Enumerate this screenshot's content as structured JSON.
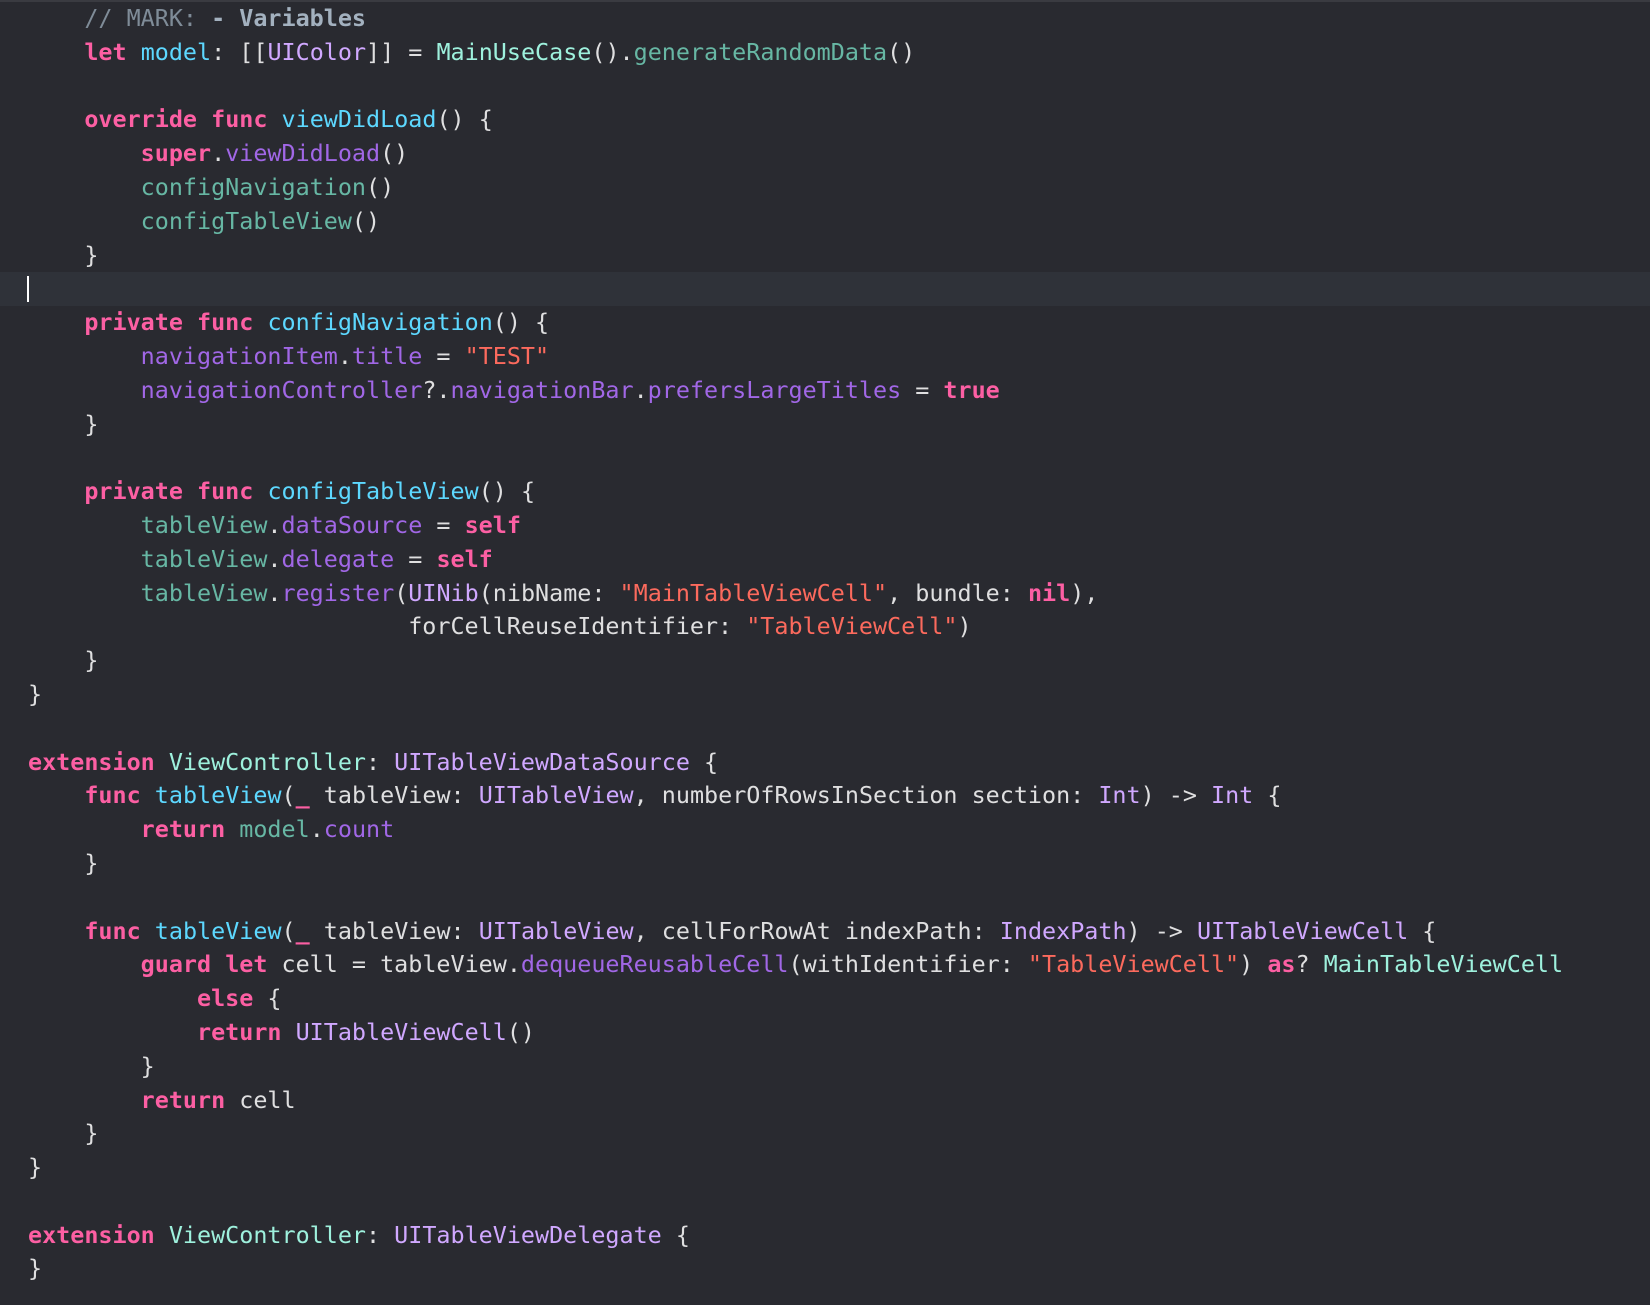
{
  "editor": {
    "language": "swift",
    "theme": {
      "background": "#292a30",
      "current_line": "#2f3239",
      "keyword": "#fc5fa3",
      "string": "#fc6a5d",
      "comment": "#7f8c98",
      "type_declaration": "#5dd8ff",
      "system_type": "#d0a8ff",
      "project_type": "#9ef1dd",
      "project_function": "#67b7a4",
      "system_property": "#a167e6",
      "plain": "#dfdfe0"
    },
    "cursor_line_index": 8,
    "lines": [
      [
        {
          "t": "    "
        },
        {
          "t": "// MARK: ",
          "c": "comment"
        },
        {
          "t": "- Variables",
          "c": "mark"
        }
      ],
      [
        {
          "t": "    "
        },
        {
          "t": "let",
          "c": "kw"
        },
        {
          "t": " "
        },
        {
          "t": "model",
          "c": "decl"
        },
        {
          "t": ": [["
        },
        {
          "t": "UIColor",
          "c": "type"
        },
        {
          "t": "]] = "
        },
        {
          "t": "MainUseCase",
          "c": "projtype"
        },
        {
          "t": "()."
        },
        {
          "t": "generateRandomData",
          "c": "projfunc"
        },
        {
          "t": "()"
        }
      ],
      [],
      [
        {
          "t": "    "
        },
        {
          "t": "override",
          "c": "kw"
        },
        {
          "t": " "
        },
        {
          "t": "func",
          "c": "kw"
        },
        {
          "t": " "
        },
        {
          "t": "viewDidLoad",
          "c": "decl"
        },
        {
          "t": "() {"
        }
      ],
      [
        {
          "t": "        "
        },
        {
          "t": "super",
          "c": "kw"
        },
        {
          "t": "."
        },
        {
          "t": "viewDidLoad",
          "c": "sysprop"
        },
        {
          "t": "()"
        }
      ],
      [
        {
          "t": "        "
        },
        {
          "t": "configNavigation",
          "c": "projfunc"
        },
        {
          "t": "()"
        }
      ],
      [
        {
          "t": "        "
        },
        {
          "t": "configTableView",
          "c": "projfunc"
        },
        {
          "t": "()"
        }
      ],
      [
        {
          "t": "    }"
        }
      ],
      [],
      [
        {
          "t": "    "
        },
        {
          "t": "private",
          "c": "kw"
        },
        {
          "t": " "
        },
        {
          "t": "func",
          "c": "kw"
        },
        {
          "t": " "
        },
        {
          "t": "configNavigation",
          "c": "decl"
        },
        {
          "t": "() {"
        }
      ],
      [
        {
          "t": "        "
        },
        {
          "t": "navigationItem",
          "c": "sysprop"
        },
        {
          "t": "."
        },
        {
          "t": "title",
          "c": "sysprop"
        },
        {
          "t": " = "
        },
        {
          "t": "\"TEST\"",
          "c": "str"
        }
      ],
      [
        {
          "t": "        "
        },
        {
          "t": "navigationController",
          "c": "sysprop"
        },
        {
          "t": "?."
        },
        {
          "t": "navigationBar",
          "c": "sysprop"
        },
        {
          "t": "."
        },
        {
          "t": "prefersLargeTitles",
          "c": "sysprop"
        },
        {
          "t": " = "
        },
        {
          "t": "true",
          "c": "kw"
        }
      ],
      [
        {
          "t": "    }"
        }
      ],
      [],
      [
        {
          "t": "    "
        },
        {
          "t": "private",
          "c": "kw"
        },
        {
          "t": " "
        },
        {
          "t": "func",
          "c": "kw"
        },
        {
          "t": " "
        },
        {
          "t": "configTableView",
          "c": "decl"
        },
        {
          "t": "() {"
        }
      ],
      [
        {
          "t": "        "
        },
        {
          "t": "tableView",
          "c": "projfunc"
        },
        {
          "t": "."
        },
        {
          "t": "dataSource",
          "c": "sysprop"
        },
        {
          "t": " = "
        },
        {
          "t": "self",
          "c": "kw"
        }
      ],
      [
        {
          "t": "        "
        },
        {
          "t": "tableView",
          "c": "projfunc"
        },
        {
          "t": "."
        },
        {
          "t": "delegate",
          "c": "sysprop"
        },
        {
          "t": " = "
        },
        {
          "t": "self",
          "c": "kw"
        }
      ],
      [
        {
          "t": "        "
        },
        {
          "t": "tableView",
          "c": "projfunc"
        },
        {
          "t": "."
        },
        {
          "t": "register",
          "c": "sysprop"
        },
        {
          "t": "("
        },
        {
          "t": "UINib",
          "c": "type"
        },
        {
          "t": "(nibName: "
        },
        {
          "t": "\"MainTableViewCell\"",
          "c": "str"
        },
        {
          "t": ", bundle: "
        },
        {
          "t": "nil",
          "c": "kw"
        },
        {
          "t": "),"
        }
      ],
      [
        {
          "t": "                           forCellReuseIdentifier: "
        },
        {
          "t": "\"TableViewCell\"",
          "c": "str"
        },
        {
          "t": ")"
        }
      ],
      [
        {
          "t": "    }"
        }
      ],
      [
        {
          "t": "}"
        }
      ],
      [],
      [
        {
          "t": "extension",
          "c": "kw"
        },
        {
          "t": " "
        },
        {
          "t": "ViewController",
          "c": "projtype"
        },
        {
          "t": ": "
        },
        {
          "t": "UITableViewDataSource",
          "c": "type"
        },
        {
          "t": " {"
        }
      ],
      [
        {
          "t": "    "
        },
        {
          "t": "func",
          "c": "kw"
        },
        {
          "t": " "
        },
        {
          "t": "tableView",
          "c": "decl"
        },
        {
          "t": "("
        },
        {
          "t": "_",
          "c": "kw"
        },
        {
          "t": " tableView: "
        },
        {
          "t": "UITableView",
          "c": "type"
        },
        {
          "t": ", numberOfRowsInSection section: "
        },
        {
          "t": "Int",
          "c": "type"
        },
        {
          "t": ") -> "
        },
        {
          "t": "Int",
          "c": "type"
        },
        {
          "t": " {"
        }
      ],
      [
        {
          "t": "        "
        },
        {
          "t": "return",
          "c": "kw"
        },
        {
          "t": " "
        },
        {
          "t": "model",
          "c": "projfunc"
        },
        {
          "t": "."
        },
        {
          "t": "count",
          "c": "sysprop"
        }
      ],
      [
        {
          "t": "    }"
        }
      ],
      [],
      [
        {
          "t": "    "
        },
        {
          "t": "func",
          "c": "kw"
        },
        {
          "t": " "
        },
        {
          "t": "tableView",
          "c": "decl"
        },
        {
          "t": "("
        },
        {
          "t": "_",
          "c": "kw"
        },
        {
          "t": " tableView: "
        },
        {
          "t": "UITableView",
          "c": "type"
        },
        {
          "t": ", cellForRowAt indexPath: "
        },
        {
          "t": "IndexPath",
          "c": "type"
        },
        {
          "t": ") -> "
        },
        {
          "t": "UITableViewCell",
          "c": "type"
        },
        {
          "t": " {"
        }
      ],
      [
        {
          "t": "        "
        },
        {
          "t": "guard",
          "c": "kw"
        },
        {
          "t": " "
        },
        {
          "t": "let",
          "c": "kw"
        },
        {
          "t": " cell = tableView."
        },
        {
          "t": "dequeueReusableCell",
          "c": "sysprop"
        },
        {
          "t": "(withIdentifier: "
        },
        {
          "t": "\"TableViewCell\"",
          "c": "str"
        },
        {
          "t": ") "
        },
        {
          "t": "as",
          "c": "kw"
        },
        {
          "t": "? "
        },
        {
          "t": "MainTableViewCell",
          "c": "projtype"
        }
      ],
      [
        {
          "t": "            "
        },
        {
          "t": "else",
          "c": "kw"
        },
        {
          "t": " {"
        }
      ],
      [
        {
          "t": "            "
        },
        {
          "t": "return",
          "c": "kw"
        },
        {
          "t": " "
        },
        {
          "t": "UITableViewCell",
          "c": "type"
        },
        {
          "t": "()"
        }
      ],
      [
        {
          "t": "        }"
        }
      ],
      [
        {
          "t": "        "
        },
        {
          "t": "return",
          "c": "kw"
        },
        {
          "t": " cell"
        }
      ],
      [
        {
          "t": "    }"
        }
      ],
      [
        {
          "t": "}"
        }
      ],
      [],
      [
        {
          "t": "extension",
          "c": "kw"
        },
        {
          "t": " "
        },
        {
          "t": "ViewController",
          "c": "projtype"
        },
        {
          "t": ": "
        },
        {
          "t": "UITableViewDelegate",
          "c": "type"
        },
        {
          "t": " {"
        }
      ],
      [
        {
          "t": "}"
        }
      ]
    ]
  }
}
